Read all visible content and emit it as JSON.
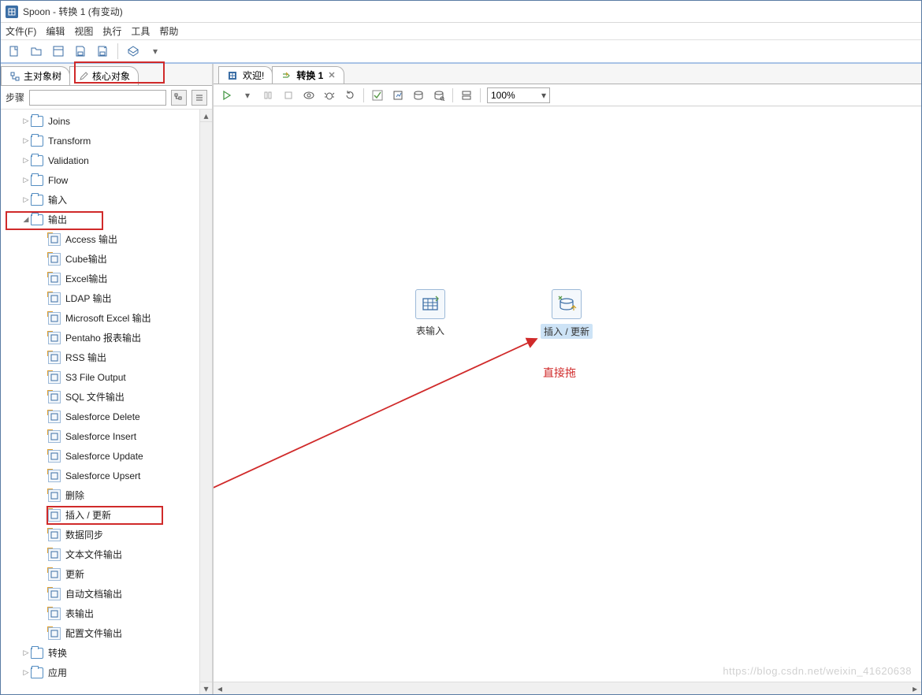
{
  "window": {
    "title": "Spoon - 转换 1 (有变动)"
  },
  "menu": {
    "file": "文件(F)",
    "edit": "编辑",
    "view": "视图",
    "run": "执行",
    "tools": "工具",
    "help": "帮助"
  },
  "sidebar": {
    "tab_main_tree": "主对象树",
    "tab_core": "核心对象",
    "filter_label": "步骤",
    "filter_placeholder": "",
    "folders_before": [
      "Joins",
      "Transform",
      "Validation",
      "Flow",
      "输入"
    ],
    "expanded_folder": "输出",
    "output_steps": [
      "Access 输出",
      "Cube输出",
      "Excel输出",
      "LDAP 输出",
      "Microsoft Excel 输出",
      "Pentaho 报表输出",
      "RSS 输出",
      "S3 File Output",
      "SQL 文件输出",
      "Salesforce Delete",
      "Salesforce Insert",
      "Salesforce Update",
      "Salesforce Upsert",
      "删除",
      "插入 / 更新",
      "数据同步",
      "文本文件输出",
      "更新",
      "自动文档输出",
      "表输出",
      "配置文件输出"
    ],
    "folders_after": [
      "转换",
      "应用"
    ]
  },
  "editor": {
    "tab_welcome": "欢迎!",
    "tab_transform": "转换 1",
    "zoom": "100%",
    "nodes": {
      "table_input": "表输入",
      "insert_update": "插入 / 更新"
    }
  },
  "annotation": "直接拖",
  "watermark": "https://blog.csdn.net/weixin_41620638"
}
